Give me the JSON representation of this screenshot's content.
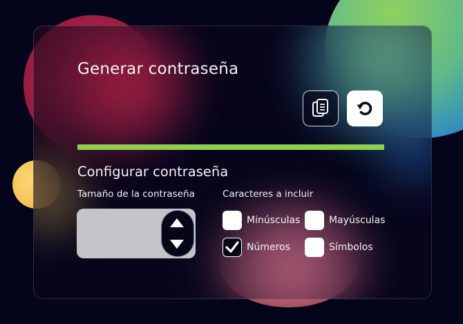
{
  "generator": {
    "title": "Generar contraseña",
    "copy_icon": "copy-document-icon",
    "refresh_icon": "refresh-icon",
    "strength": 1.0,
    "strength_color": "#8fce4e"
  },
  "config": {
    "title": "Configurar contraseña",
    "length_label": "Tamaño de la contraseña",
    "length_value": "",
    "chars_label": "Caracteres a incluir",
    "options": [
      {
        "label": "Minúsculas",
        "checked": false
      },
      {
        "label": "Mayúsculas",
        "checked": false
      },
      {
        "label": "Números",
        "checked": true
      },
      {
        "label": "Símbolos",
        "checked": false
      }
    ]
  }
}
